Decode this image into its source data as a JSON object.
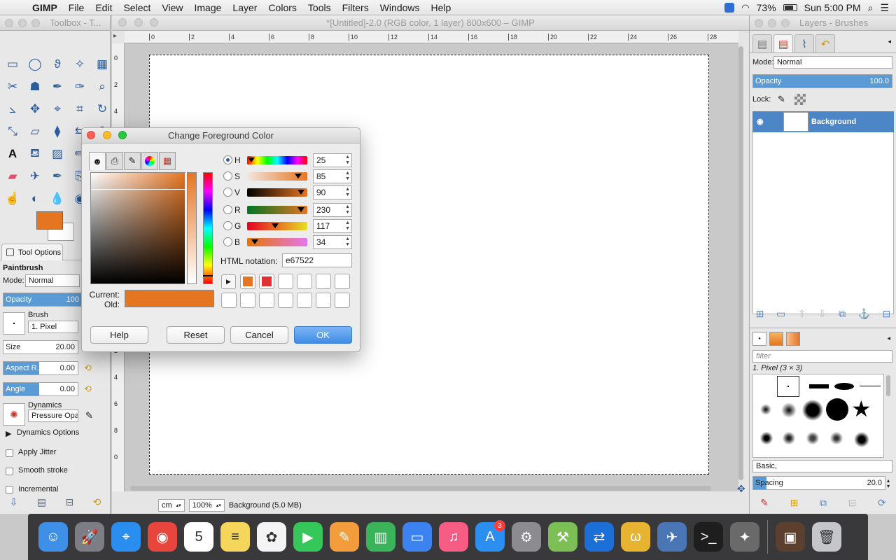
{
  "menubar": {
    "app": "GIMP",
    "items": [
      "File",
      "Edit",
      "Select",
      "View",
      "Image",
      "Layer",
      "Colors",
      "Tools",
      "Filters",
      "Windows",
      "Help"
    ],
    "battery": "73%",
    "clock": "Sun 5:00 PM"
  },
  "toolbox": {
    "title": "Toolbox - T...",
    "tools": [
      "rect-select",
      "ellipse-select",
      "free-select",
      "fuzzy-select",
      "select-by-color",
      "scissors",
      "foreground-select",
      "paths",
      "color-picker",
      "zoom",
      "measure",
      "move",
      "align",
      "crop",
      "rotate",
      "scale",
      "shear",
      "perspective",
      "flip",
      "cage",
      "text",
      "bucket-fill",
      "blend",
      "pencil",
      "paintbrush",
      "eraser",
      "airbrush",
      "ink",
      "clone",
      "heal",
      "smudge",
      "dodge-burn",
      "blur",
      "convolve",
      "ellipse"
    ],
    "fg_color": "#e67522",
    "tab_label": "Tool Options",
    "tool_name": "Paintbrush",
    "mode_label": "Mode:",
    "mode_value": "Normal",
    "opacity_label": "Opacity",
    "opacity_value": "100",
    "brush_label": "Brush",
    "brush_value": "1. Pixel",
    "size_label": "Size",
    "size_value": "20.00",
    "aspect_label": "Aspect R...",
    "aspect_value": "0.00",
    "angle_label": "Angle",
    "angle_value": "0.00",
    "dynamics_label": "Dynamics",
    "dynamics_value": "Pressure Opacity",
    "dynamics_options": "Dynamics Options",
    "apply_jitter": "Apply Jitter",
    "smooth_stroke": "Smooth stroke",
    "incremental": "Incremental"
  },
  "canvas": {
    "title": "*[Untitled]-2.0 (RGB color, 1 layer) 800x600 – GIMP",
    "ruler_h": [
      "0",
      "2",
      "4",
      "6",
      "8",
      "10",
      "12",
      "14",
      "16",
      "18",
      "20",
      "22",
      "24",
      "26",
      "28"
    ],
    "ruler_v": [
      "0",
      "2",
      "4",
      "6",
      "8",
      "0",
      "2",
      "4",
      "6",
      "8",
      "0",
      "2",
      "4",
      "6",
      "8",
      "0"
    ],
    "unit": "cm",
    "zoom": "100%",
    "layer_info": "Background (5.0 MB)"
  },
  "layers": {
    "title": "Layers - Brushes",
    "mode_label": "Mode:",
    "mode_value": "Normal",
    "opacity_label": "Opacity",
    "opacity_value": "100.0",
    "lock_label": "Lock:",
    "layer_name": "Background",
    "filter_placeholder": "filter",
    "brush_name": "1. Pixel (3 × 3)",
    "tag_value": "Basic,",
    "spacing_label": "Spacing",
    "spacing_value": "20.0"
  },
  "dialog": {
    "title": "Change Foreground Color",
    "channels": [
      {
        "name": "H",
        "value": "25",
        "selected": true,
        "marker": 0.07
      },
      {
        "name": "S",
        "value": "85",
        "selected": false,
        "marker": 0.85
      },
      {
        "name": "V",
        "value": "90",
        "selected": false,
        "marker": 0.9
      },
      {
        "name": "R",
        "value": "230",
        "selected": false,
        "marker": 0.9
      },
      {
        "name": "G",
        "value": "117",
        "selected": false,
        "marker": 0.46
      },
      {
        "name": "B",
        "value": "34",
        "selected": false,
        "marker": 0.13
      }
    ],
    "html_label": "HTML notation:",
    "html_value": "e67522",
    "current_label": "Current:",
    "old_label": "Old:",
    "current_color": "#e67522",
    "old_color": "#e67522",
    "history": [
      "#e67522",
      "#e03230",
      "#ffffff",
      "#ffffff",
      "#ffffff",
      "#ffffff",
      "#ffffff",
      "#ffffff",
      "#ffffff",
      "#ffffff",
      "#ffffff",
      "#ffffff",
      "#ffffff"
    ],
    "buttons": {
      "help": "Help",
      "reset": "Reset",
      "cancel": "Cancel",
      "ok": "OK"
    }
  },
  "dock": {
    "apps": [
      {
        "name": "finder",
        "color": "#3d8fe8",
        "glyph": "☺"
      },
      {
        "name": "launchpad",
        "color": "#7d7d85",
        "glyph": "🚀"
      },
      {
        "name": "safari",
        "color": "#2a8df0",
        "glyph": "⌖"
      },
      {
        "name": "chrome",
        "color": "#e8453c",
        "glyph": "◉"
      },
      {
        "name": "calendar",
        "color": "#ffffff",
        "glyph": "5"
      },
      {
        "name": "notes",
        "color": "#f6d65a",
        "glyph": "≡"
      },
      {
        "name": "photos",
        "color": "#f4f4f4",
        "glyph": "✿"
      },
      {
        "name": "facetime",
        "color": "#35c759",
        "glyph": "▶"
      },
      {
        "name": "pages",
        "color": "#f39c3c",
        "glyph": "✎"
      },
      {
        "name": "numbers",
        "color": "#3bb35b",
        "glyph": "▥"
      },
      {
        "name": "keynote",
        "color": "#3c82f0",
        "glyph": "▭"
      },
      {
        "name": "itunes",
        "color": "#f65c84",
        "glyph": "♫"
      },
      {
        "name": "app-store",
        "color": "#2b8ff2",
        "glyph": "A",
        "badge": "3"
      },
      {
        "name": "system-preferences",
        "color": "#8c8c90",
        "glyph": "⚙"
      },
      {
        "name": "android-studio",
        "color": "#7bbf55",
        "glyph": "⚒"
      },
      {
        "name": "teamviewer",
        "color": "#1d6fd8",
        "glyph": "⇄"
      },
      {
        "name": "fetch",
        "color": "#e8b330",
        "glyph": "ω"
      },
      {
        "name": "preview",
        "color": "#4a76b5",
        "glyph": "✈"
      },
      {
        "name": "terminal",
        "color": "#1e1e1e",
        "glyph": ">_"
      },
      {
        "name": "gimp",
        "color": "#6a6a6a",
        "glyph": "✦"
      }
    ],
    "right_apps": [
      {
        "name": "downloads",
        "color": "#5b4030",
        "glyph": "▣"
      },
      {
        "name": "trash",
        "color": "#c4c6c9",
        "glyph": "🗑"
      }
    ]
  }
}
